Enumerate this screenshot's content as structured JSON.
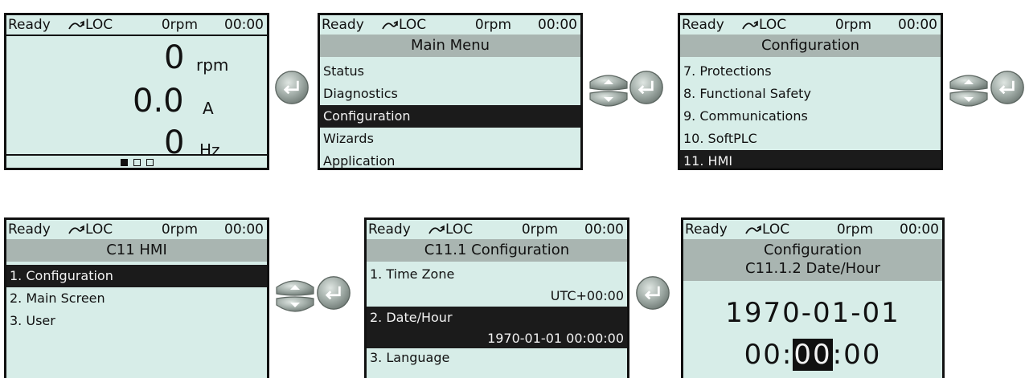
{
  "status_bar": {
    "state": "Ready",
    "mode": "LOC",
    "speed": "0rpm",
    "time": "00:00"
  },
  "home_screen": {
    "speed": {
      "value": "0",
      "unit": "rpm"
    },
    "current": {
      "value": "0.0",
      "unit": "A"
    },
    "frequency": {
      "value": "0",
      "unit": "Hz"
    },
    "page_indicator": {
      "active_page": 1,
      "total_pages": 3
    }
  },
  "main_menu": {
    "title": "Main Menu",
    "items": [
      "Status",
      "Diagnostics",
      "Configuration",
      "Wizards",
      "Application"
    ],
    "selected": "Configuration"
  },
  "configuration_menu": {
    "title": "Configuration",
    "items": [
      "7. Protections",
      "8. Functional Safety",
      "9. Communications",
      "10. SoftPLC",
      "11. HMI"
    ],
    "selected": "11. HMI"
  },
  "hmi_menu": {
    "title": "C11 HMI",
    "items": [
      "1. Configuration",
      "2. Main Screen",
      "3. User"
    ],
    "selected": "1. Configuration"
  },
  "hmi_config_menu": {
    "title": "C11.1 Configuration",
    "items": [
      {
        "label": "1. Time Zone",
        "value": "UTC+00:00"
      },
      {
        "label": "2. Date/Hour",
        "value": "1970-01-01 00:00:00"
      },
      {
        "label": "3. Language"
      }
    ],
    "selected": "2. Date/Hour"
  },
  "date_hour_screen": {
    "title_line1": "Configuration",
    "title_line2": "C11.1.2 Date/Hour",
    "date": "1970-01-01",
    "time_hours": "00",
    "time_minutes": "00",
    "time_seconds": "00",
    "time_separator": ":",
    "editing_field": "minutes"
  },
  "icons": {
    "enter_key": "enter-key-icon",
    "up_down_keys": "up-down-arrow-keys-icon",
    "local_mode": "rotation-arrow-icon"
  },
  "colors": {
    "screen_background": "#d7ede8",
    "title_bar": "#a9b5b1",
    "selection": "#1b1b1b",
    "button_face": "#9aa59f"
  }
}
